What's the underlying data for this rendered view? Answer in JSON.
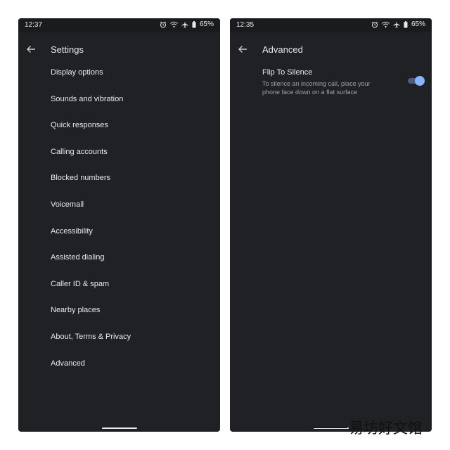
{
  "left_screen": {
    "status": {
      "time": "12:37",
      "battery": "65%"
    },
    "title": "Settings",
    "menu": [
      "Display options",
      "Sounds and vibration",
      "Quick responses",
      "Calling accounts",
      "Blocked numbers",
      "Voicemail",
      "Accessibility",
      "Assisted dialing",
      "Caller ID & spam",
      "Nearby places",
      "About, Terms & Privacy",
      "Advanced"
    ]
  },
  "right_screen": {
    "status": {
      "time": "12:35",
      "battery": "65%"
    },
    "title": "Advanced",
    "setting": {
      "title": "Flip To Silence",
      "description": "To silence an incoming call, place your phone face down on a flat surface",
      "enabled": true
    }
  },
  "watermark": {
    "text": "易坊好文馆"
  },
  "colors": {
    "background": "#202124",
    "accent": "#8ab4f8",
    "text": "#e8eaed",
    "secondary": "#9aa0a6"
  },
  "icons": [
    "alarm-icon",
    "wifi-icon",
    "airplane-icon",
    "battery-icon",
    "back-arrow-icon"
  ]
}
